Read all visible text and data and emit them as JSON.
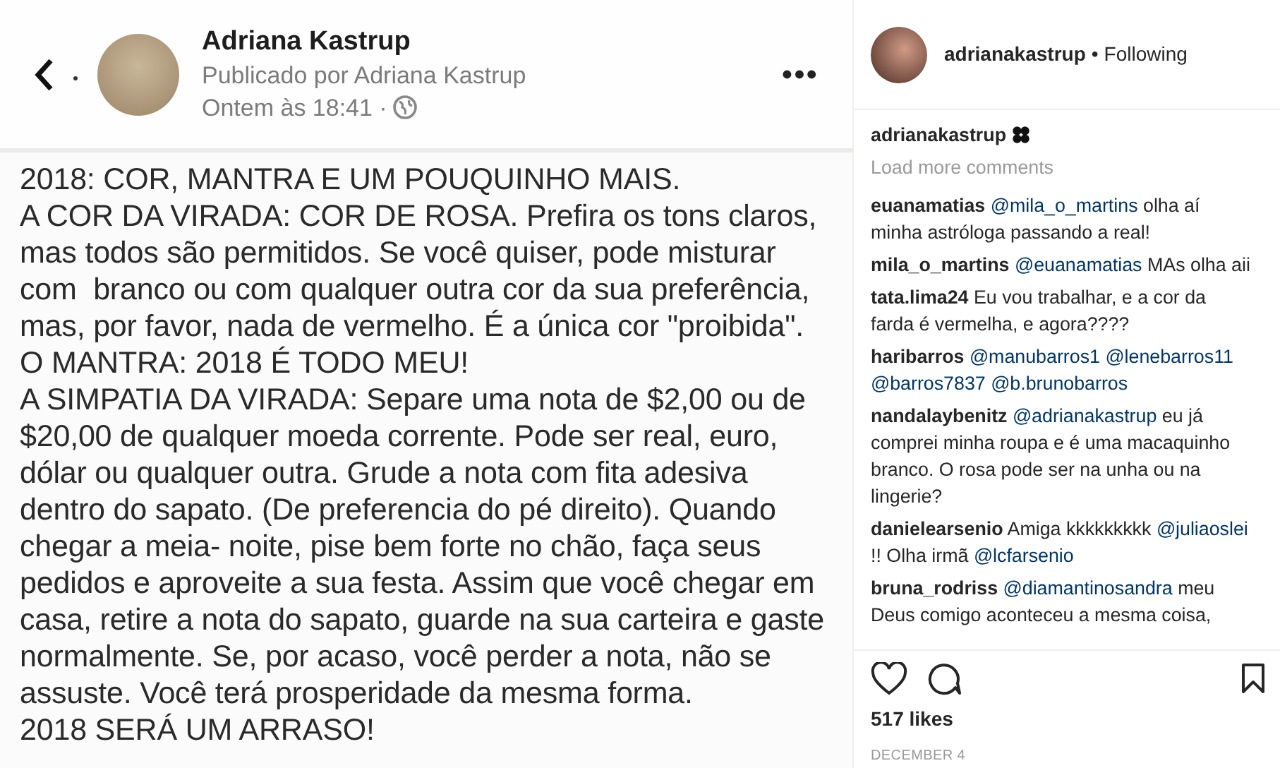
{
  "post_image": {
    "author": "Adriana Kastrup",
    "published_by": "Publicado por Adriana Kastrup",
    "time": "Ontem às 18:41 ·",
    "more": "•••",
    "lines": [
      "2018: COR, MANTRA E UM POUQUINHO MAIS.",
      "A COR DA VIRADA: COR DE ROSA. Prefira os tons claros,",
      "mas todos são permitidos. Se você quiser, pode misturar",
      "com  branco ou com qualquer outra cor da sua preferência,",
      "mas, por favor, nada de vermelho. É a única cor \"proibida\".",
      "O MANTRA: 2018 É TODO MEU!",
      "A SIMPATIA DA VIRADA: Separe uma nota de $2,00 ou de",
      "$20,00 de qualquer moeda corrente. Pode ser real, euro,",
      "dólar ou qualquer outra. Grude a nota com fita adesiva",
      "dentro do sapato. (De preferencia do pé direito). Quando",
      "chegar a meia- noite, pise bem forte no chão, faça seus",
      "pedidos e aproveite a sua festa. Assim que você chegar em",
      "casa, retire a nota do sapato, guarde na sua carteira e gaste",
      "normalmente. Se, por acaso, você perder a nota, não se",
      "assuste. Você terá prosperidade da mesma forma.",
      "2018 SERÁ UM ARRASO!"
    ]
  },
  "header": {
    "username": "adrianakastrup",
    "separator": "•",
    "follow": "Following"
  },
  "caption": {
    "username": "adrianakastrup"
  },
  "load_more": "Load more comments",
  "comments": [
    {
      "parts": [
        {
          "kind": "user",
          "text": "euanamatias"
        },
        {
          "kind": "mention",
          "text": "@mila_o_martins"
        },
        {
          "kind": "text",
          "text": "olha aí minha astróloga passando a real!"
        }
      ]
    },
    {
      "parts": [
        {
          "kind": "user",
          "text": "mila_o_martins"
        },
        {
          "kind": "mention",
          "text": "@euanamatias"
        },
        {
          "kind": "text",
          "text": "MAs olha aii"
        }
      ]
    },
    {
      "parts": [
        {
          "kind": "user",
          "text": "tata.lima24"
        },
        {
          "kind": "text",
          "text": "Eu vou trabalhar, e a cor da farda é vermelha, e agora????"
        }
      ]
    },
    {
      "parts": [
        {
          "kind": "user",
          "text": "haribarros"
        },
        {
          "kind": "mention",
          "text": "@manubarros1"
        },
        {
          "kind": "mention",
          "text": "@lenebarros11"
        },
        {
          "kind": "mention",
          "text": "@barros7837"
        },
        {
          "kind": "mention",
          "text": "@b.brunobarros"
        }
      ]
    },
    {
      "parts": [
        {
          "kind": "user",
          "text": "nandalaybenitz"
        },
        {
          "kind": "mention",
          "text": "@adrianakastrup"
        },
        {
          "kind": "text",
          "text": "eu já comprei minha roupa e é uma macaquinho branco. O rosa pode ser na unha ou na lingerie?"
        }
      ]
    },
    {
      "parts": [
        {
          "kind": "user",
          "text": "danielearsenio"
        },
        {
          "kind": "text",
          "text": "Amiga kkkkkkkkk"
        },
        {
          "kind": "mention",
          "text": "@juliaoslei"
        },
        {
          "kind": "text",
          "text": "!! Olha irmã"
        },
        {
          "kind": "mention",
          "text": "@lcfarsenio"
        }
      ]
    },
    {
      "parts": [
        {
          "kind": "user",
          "text": "bruna_rodriss"
        },
        {
          "kind": "mention",
          "text": "@diamantinosandra"
        },
        {
          "kind": "text",
          "text": "meu Deus comigo aconteceu a mesma coisa,"
        }
      ]
    }
  ],
  "likes": "517 likes",
  "date": "DECEMBER 4",
  "liked": false,
  "saved": false
}
